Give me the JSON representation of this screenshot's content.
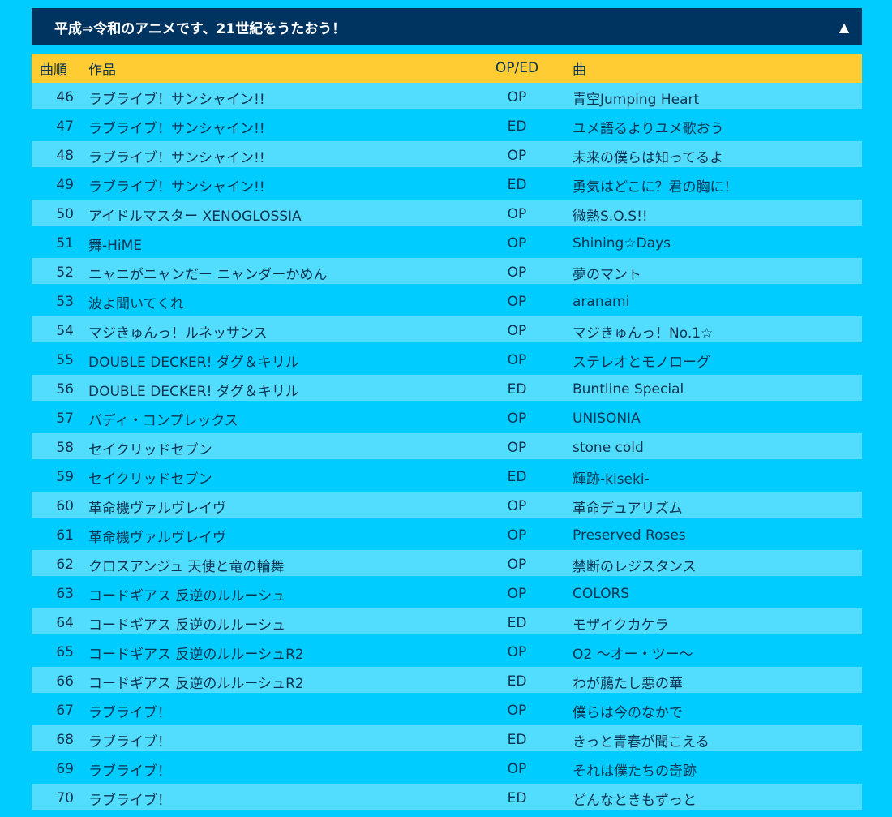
{
  "header": {
    "title": "平成⇒令和のアニメです、21世紀をうたおう！",
    "toggle_icon": "▲"
  },
  "columns": {
    "no": "曲順",
    "work": "作品",
    "oped": "OP/ED",
    "song": "曲"
  },
  "rows": [
    {
      "no": "46",
      "work": "ラブライブ！サンシャイン!!",
      "oped": "OP",
      "song": "青空Jumping Heart"
    },
    {
      "no": "47",
      "work": "ラブライブ！サンシャイン!!",
      "oped": "ED",
      "song": "ユメ語るよりユメ歌おう"
    },
    {
      "no": "48",
      "work": "ラブライブ！サンシャイン!!",
      "oped": "OP",
      "song": "未来の僕らは知ってるよ"
    },
    {
      "no": "49",
      "work": "ラブライブ！サンシャイン!!",
      "oped": "ED",
      "song": "勇気はどこに？君の胸に！"
    },
    {
      "no": "50",
      "work": "アイドルマスター XENOGLOSSIA",
      "oped": "OP",
      "song": "微熱S.O.S!!"
    },
    {
      "no": "51",
      "work": "舞-HiME",
      "oped": "OP",
      "song": "Shining☆Days"
    },
    {
      "no": "52",
      "work": "ニャニがニャンだー ニャンダーかめん",
      "oped": "OP",
      "song": "夢のマント"
    },
    {
      "no": "53",
      "work": "波よ聞いてくれ",
      "oped": "OP",
      "song": "aranami"
    },
    {
      "no": "54",
      "work": "マジきゅんっ！ルネッサンス",
      "oped": "OP",
      "song": "マジきゅんっ！No.1☆"
    },
    {
      "no": "55",
      "work": "DOUBLE DECKER! ダグ＆キリル",
      "oped": "OP",
      "song": "ステレオとモノローグ"
    },
    {
      "no": "56",
      "work": "DOUBLE DECKER! ダグ＆キリル",
      "oped": "ED",
      "song": "Buntline Special"
    },
    {
      "no": "57",
      "work": "バディ・コンプレックス",
      "oped": "OP",
      "song": "UNISONIA"
    },
    {
      "no": "58",
      "work": "セイクリッドセブン",
      "oped": "OP",
      "song": "stone cold"
    },
    {
      "no": "59",
      "work": "セイクリッドセブン",
      "oped": "ED",
      "song": "輝跡-kiseki-"
    },
    {
      "no": "60",
      "work": "革命機ヴァルヴレイヴ",
      "oped": "OP",
      "song": "革命デュアリズム"
    },
    {
      "no": "61",
      "work": "革命機ヴァルヴレイヴ",
      "oped": "OP",
      "song": "Preserved Roses"
    },
    {
      "no": "62",
      "work": "クロスアンジュ 天使と竜の輪舞",
      "oped": "OP",
      "song": "禁断のレジスタンス"
    },
    {
      "no": "63",
      "work": "コードギアス 反逆のルルーシュ",
      "oped": "OP",
      "song": "COLORS"
    },
    {
      "no": "64",
      "work": "コードギアス 反逆のルルーシュ",
      "oped": "ED",
      "song": "モザイクカケラ"
    },
    {
      "no": "65",
      "work": "コードギアス 反逆のルルーシュR2",
      "oped": "OP",
      "song": "O2 ～オー・ツー～"
    },
    {
      "no": "66",
      "work": "コードギアス 反逆のルルーシュR2",
      "oped": "ED",
      "song": "わが﨟たし悪の華"
    },
    {
      "no": "67",
      "work": "ラブライブ！",
      "oped": "OP",
      "song": "僕らは今のなかで"
    },
    {
      "no": "68",
      "work": "ラブライブ！",
      "oped": "ED",
      "song": "きっと青春が聞こえる"
    },
    {
      "no": "69",
      "work": "ラブライブ！",
      "oped": "OP",
      "song": "それは僕たちの奇跡"
    },
    {
      "no": "70",
      "work": "ラブライブ！",
      "oped": "ED",
      "song": "どんなときもずっと"
    }
  ],
  "colors": {
    "background": "#00ccff",
    "header_bg": "#003460",
    "table_head_bg": "#ffcc33",
    "row_light": "#52ddff"
  }
}
